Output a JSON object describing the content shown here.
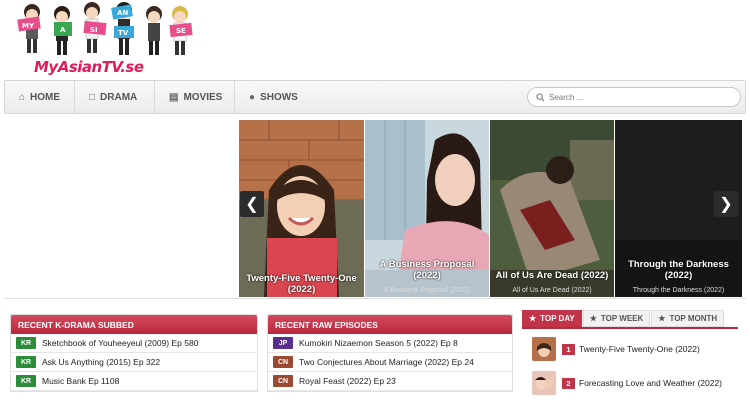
{
  "site": {
    "logo_text": "MyAsianTV.se",
    "logo_letters": [
      "MY",
      "A",
      "SI",
      "AN",
      "TV",
      "SE"
    ]
  },
  "nav": {
    "home": "HOME",
    "drama": "DRAMA",
    "movies": "MOVIES",
    "shows": "SHOWS",
    "search_placeholder": "Search ..."
  },
  "slider": [
    {
      "title": "Twenty-Five Twenty-One (2022)",
      "subtitle": ""
    },
    {
      "title": "A Business Proposal (2022)",
      "subtitle": "A Business Proposal (2022)"
    },
    {
      "title": "All of Us Are Dead (2022)",
      "subtitle": "All of Us Are Dead (2022)"
    },
    {
      "title": "Through the Darkness (2022)",
      "subtitle": "Through the Darkness (2022)"
    }
  ],
  "recent_kdrama": {
    "heading": "RECENT K-DRAMA SUBBED",
    "items": [
      {
        "tag": "KR",
        "title": "Sketchbook of Youheeyeul (2009) Ep 580"
      },
      {
        "tag": "KR",
        "title": "Ask Us Anything (2015) Ep 322"
      },
      {
        "tag": "KR",
        "title": "Music Bank Ep 1108"
      }
    ]
  },
  "recent_raw": {
    "heading": "RECENT RAW EPISODES",
    "items": [
      {
        "tag": "JP",
        "title": "Kumokiri Nizaemon Season 5 (2022) Ep 8"
      },
      {
        "tag": "CN",
        "title": "Two Conjectures About Marriage (2022) Ep 24"
      },
      {
        "tag": "CN",
        "title": "Royal Feast (2022) Ep 23"
      }
    ]
  },
  "top": {
    "tabs": [
      "TOP DAY",
      "TOP WEEK",
      "TOP MONTH"
    ],
    "items": [
      {
        "rank": "1",
        "title": "Twenty-Five Twenty-One (2022)"
      },
      {
        "rank": "2",
        "title": "Forecasting Love and Weather (2022)"
      }
    ]
  },
  "colors": {
    "accent": "#c2344a",
    "tag_kr": "#2e8b3b",
    "tag_jp": "#5a2d91",
    "tag_cn": "#9a4a32"
  }
}
